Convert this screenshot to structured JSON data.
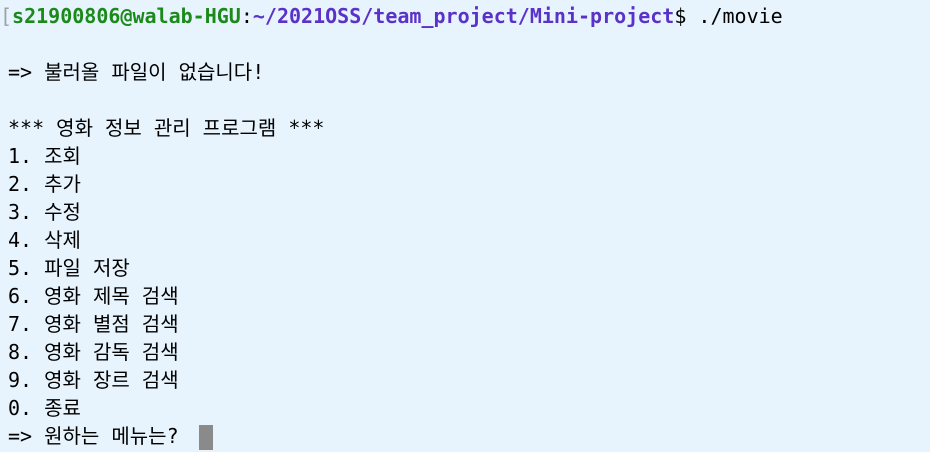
{
  "prompt": {
    "bracket": "[",
    "user_host": "s21900806@walab-HGU",
    "colon": ":",
    "cwd": "~/2021OSS/team_project/Mini-project",
    "symbol": "$",
    "command": " ./movie"
  },
  "output": {
    "load_message": "=> 불러올 파일이 없습니다!",
    "title": "*** 영화 정보 관리 프로그램 ***",
    "menu_items": [
      "1. 조회",
      "2. 추가",
      "3. 수정",
      "4. 삭제",
      "5. 파일 저장",
      "6. 영화 제목 검색",
      "7. 영화 별점 검색",
      "8. 영화 감독 검색",
      "9. 영화 장르 검색",
      "0. 종료"
    ],
    "input_prompt": "=> 원하는 메뉴는? "
  },
  "colors": {
    "background": "#e7f4fd",
    "user_host": "#1b8a1b",
    "path": "#5a32c8",
    "cursor": "#8a8a8a"
  }
}
